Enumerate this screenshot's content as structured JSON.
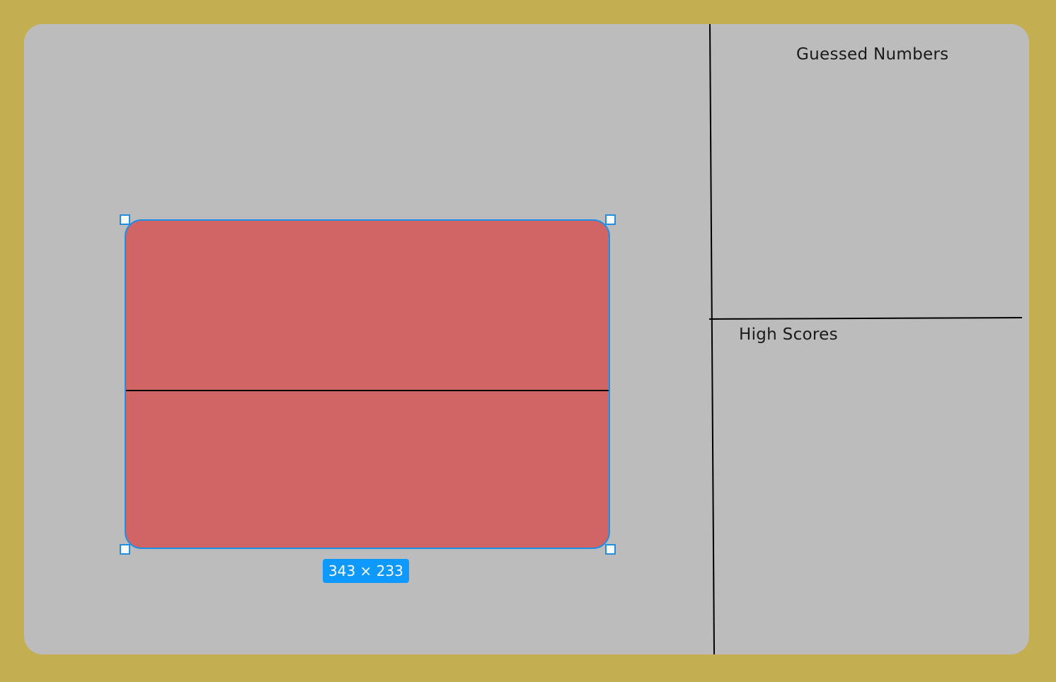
{
  "canvas": {
    "background_color": "#c3ae52",
    "panel_color": "#bcbcbc"
  },
  "sidebar": {
    "guessed_title": "Guessed Numbers",
    "scores_title": "High Scores"
  },
  "selection": {
    "fill_color": "#d16464",
    "outline_color": "#1e8fe6",
    "dimensions_label": "343 × 233"
  }
}
